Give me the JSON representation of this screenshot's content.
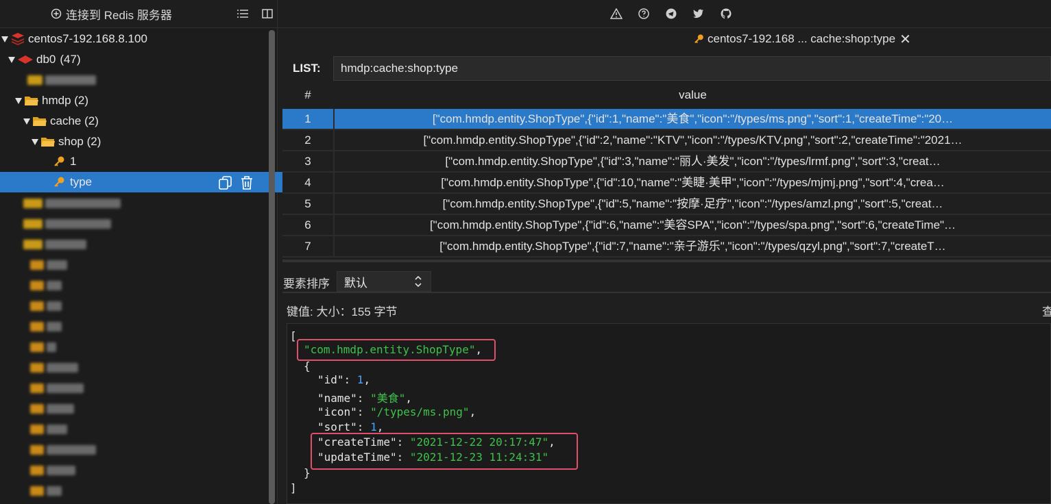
{
  "sidebar": {
    "connect_label": "连接到 Redis 服务器",
    "server": "centos7-192.168.8.100",
    "db": "db0",
    "db_count": "(47)",
    "folders": {
      "hmdp": "hmdp (2)",
      "cache": "cache (2)",
      "shop": "shop (2)"
    },
    "keys": {
      "k1": "1",
      "k2": "type"
    }
  },
  "tab": {
    "title": "centos7-192.168 ... cache:shop:type",
    "close": "✕"
  },
  "key": {
    "type_label": "LIST:",
    "name": "hmdp:cache:shop:type"
  },
  "table": {
    "col_num": "#",
    "col_value": "value",
    "rows": [
      {
        "n": "1",
        "v": "[\"com.hmdp.entity.ShopType\",{\"id\":1,\"name\":\"美食\",\"icon\":\"/types/ms.png\",\"sort\":1,\"createTime\":\"20…"
      },
      {
        "n": "2",
        "v": "[\"com.hmdp.entity.ShopType\",{\"id\":2,\"name\":\"KTV\",\"icon\":\"/types/KTV.png\",\"sort\":2,\"createTime\":\"2021…"
      },
      {
        "n": "3",
        "v": "[\"com.hmdp.entity.ShopType\",{\"id\":3,\"name\":\"丽人·美发\",\"icon\":\"/types/lrmf.png\",\"sort\":3,\"creat…"
      },
      {
        "n": "4",
        "v": "[\"com.hmdp.entity.ShopType\",{\"id\":10,\"name\":\"美睫·美甲\",\"icon\":\"/types/mjmj.png\",\"sort\":4,\"crea…"
      },
      {
        "n": "5",
        "v": "[\"com.hmdp.entity.ShopType\",{\"id\":5,\"name\":\"按摩·足疗\",\"icon\":\"/types/amzl.png\",\"sort\":5,\"creat…"
      },
      {
        "n": "6",
        "v": "[\"com.hmdp.entity.ShopType\",{\"id\":6,\"name\":\"美容SPA\",\"icon\":\"/types/spa.png\",\"sort\":6,\"createTime\"…"
      },
      {
        "n": "7",
        "v": "[\"com.hmdp.entity.ShopType\",{\"id\":7,\"name\":\"亲子游乐\",\"icon\":\"/types/qzyl.png\",\"sort\":7,\"createT…"
      }
    ]
  },
  "sort": {
    "label": "要素排序",
    "value": "默认"
  },
  "value_info": "键值: 大小：155 字节",
  "value_right_char": "查",
  "json_view": {
    "open_bracket": "[",
    "class_str": "\"com.hmdp.entity.ShopType\"",
    "open_brace": "{",
    "id_key": "\"id\"",
    "id_val": "1",
    "name_key": "\"name\"",
    "name_val": "\"美食\"",
    "icon_key": "\"icon\"",
    "icon_val": "\"/types/ms.png\"",
    "sort_key": "\"sort\"",
    "sort_val": "1",
    "create_key": "\"createTime\"",
    "create_val": "\"2021-12-22 20:17:47\"",
    "update_key": "\"updateTime\"",
    "update_val": "\"2021-12-23 11:24:31\"",
    "close_brace": "}",
    "close_bracket": "]"
  },
  "colors": {
    "selection": "#2b79c9",
    "string": "#3ec24b",
    "number": "#4aa3ff",
    "highlight": "#e0506a",
    "key_icon": "#f0a020",
    "redis_red": "#d8342a"
  }
}
